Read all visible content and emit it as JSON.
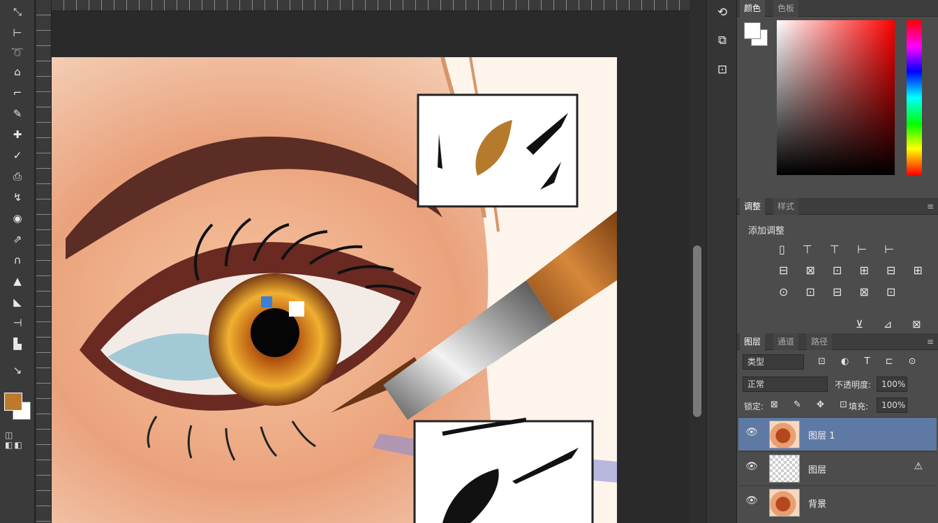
{
  "toolbar": {
    "tools": [
      {
        "name": "move-tool-icon",
        "glyph": "⤡"
      },
      {
        "name": "artboard-tool-icon",
        "glyph": "⊢"
      },
      {
        "name": "lasso-tool-icon",
        "glyph": "➰"
      },
      {
        "name": "quick-select-tool-icon",
        "glyph": "⌂"
      },
      {
        "name": "crop-tool-icon",
        "glyph": "⌐"
      },
      {
        "name": "eyedropper-tool-icon",
        "glyph": "✎"
      },
      {
        "name": "healing-brush-tool-icon",
        "glyph": "✚"
      },
      {
        "name": "brush-tool-icon",
        "glyph": "✓"
      },
      {
        "name": "clone-stamp-tool-icon",
        "glyph": "⎙"
      },
      {
        "name": "history-brush-tool-icon",
        "glyph": "↯"
      },
      {
        "name": "eraser-tool-icon",
        "glyph": "◉"
      },
      {
        "name": "gradient-tool-icon",
        "glyph": "⇗"
      },
      {
        "name": "dodge-tool-icon",
        "glyph": "∩"
      },
      {
        "name": "pen-tool-icon",
        "glyph": "▲"
      },
      {
        "name": "type-tool-icon",
        "glyph": "◣"
      },
      {
        "name": "path-select-tool-icon",
        "glyph": "⊣"
      },
      {
        "name": "shape-tool-icon",
        "glyph": "▙"
      },
      {
        "name": "hand-tool-icon",
        "glyph": "↘"
      }
    ],
    "mode_buttons": "◫ ◧◧"
  },
  "canvas": {
    "artwork_label": ""
  },
  "icon_strip": [
    {
      "name": "history-icon",
      "glyph": "⟲"
    },
    {
      "name": "properties-icon",
      "glyph": "⧉"
    },
    {
      "name": "libraries-icon",
      "glyph": "⊡"
    }
  ],
  "color_panel": {
    "tabs": [
      "颜色",
      "色板"
    ],
    "menu": "≡"
  },
  "adjustments_panel": {
    "tabs": [
      "调整",
      "样式"
    ],
    "menu": "≡",
    "title": "添加调整",
    "rows": [
      "▯ ⊤ ⊤ ⊢ ⊢",
      "⊟ ⊠ ⊡ ⊞ ⊟ ⊞",
      "⊙ ⊡ ⊟ ⊠ ⊡"
    ],
    "footer": "⊻ ⊿ ⊠"
  },
  "layers_panel": {
    "tabs": [
      "图层",
      "通道",
      "路径"
    ],
    "menu": "≡",
    "filter_kind": "类型",
    "filter_icons": "⊡ ◐ T ⊏ ⊙",
    "blend_mode": "正常",
    "opacity_label": "不透明度:",
    "opacity_value": "100%",
    "lock_label": "锁定:",
    "lock_icons": "⊠ ✎ ✥ ⊡",
    "fill_label": "填充:",
    "fill_value": "100%",
    "layers": [
      {
        "name": "图层 1",
        "selected": true,
        "thumb": "painted"
      },
      {
        "name": "图层",
        "selected": false,
        "thumb": "transparent",
        "warning": "⚠"
      },
      {
        "name": "背景",
        "selected": false,
        "thumb": "painted"
      }
    ]
  },
  "colors": {
    "foreground": "#c0782a",
    "background": "#ffffff",
    "selection": "#5e79a4"
  }
}
